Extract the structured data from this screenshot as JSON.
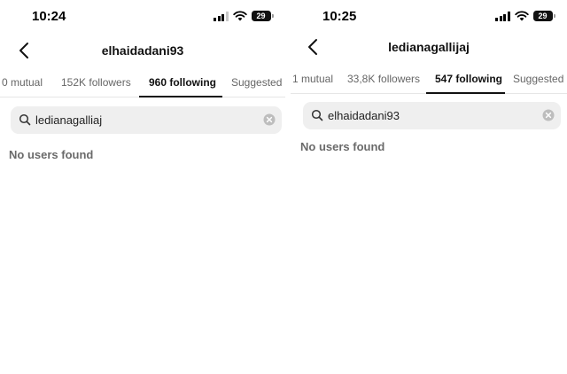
{
  "left": {
    "status": {
      "time": "10:24",
      "battery": "29"
    },
    "header": {
      "title": "elhaidadani93"
    },
    "tabs": [
      "0 mutual",
      "152K followers",
      "960 following",
      "Suggested"
    ],
    "active_tab": "960 following",
    "search": {
      "value": "ledianagalliaj"
    },
    "empty_text": "No users found"
  },
  "right": {
    "status": {
      "time": "10:25",
      "battery": "29"
    },
    "header": {
      "title": "ledianagallijaj"
    },
    "tabs": [
      "1 mutual",
      "33,8K followers",
      "547 following",
      "Suggested"
    ],
    "active_tab": "547 following",
    "search": {
      "value": "elhaidadani93"
    },
    "empty_text": "No users found"
  },
  "icons": {
    "back": "chevron-left-icon",
    "search": "search-icon",
    "clear": "clear-circle-x-icon",
    "signal": "cellular-signal-icon",
    "wifi": "wifi-icon",
    "battery": "battery-icon"
  },
  "colors": {
    "active_tab": "#111111",
    "inactive_tab": "#666666",
    "search_bg": "#efefef",
    "empty_text": "#6a6a6a"
  }
}
